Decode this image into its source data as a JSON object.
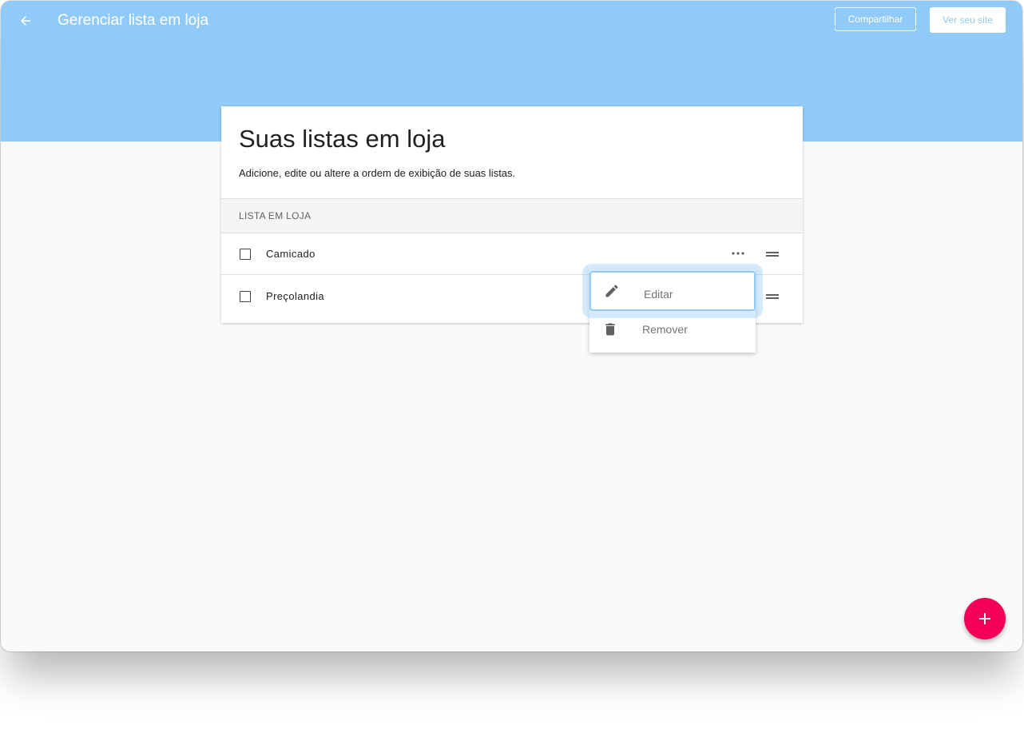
{
  "header": {
    "title": "Gerenciar lista em loja",
    "share_label": "Compartilhar",
    "view_site_label": "Ver seu site",
    "background_color": "#90caf9",
    "back_icon": "arrow-left-icon"
  },
  "card": {
    "title": "Suas listas em loja",
    "subtitle": "Adicione, edite ou altere a ordem de exibição de suas listas.",
    "section_label": "LISTA EM LOJA",
    "items": [
      {
        "label": "Camicado",
        "checked": false
      },
      {
        "label": "Preçolandia",
        "checked": false
      }
    ]
  },
  "context_menu": {
    "items": [
      {
        "label": "Editar",
        "icon": "pencil-icon",
        "highlighted": true
      },
      {
        "label": "Remover",
        "icon": "trash-icon",
        "highlighted": false
      }
    ],
    "highlight_color": "#90caf9"
  },
  "fab": {
    "icon": "plus-icon",
    "color": "#f50057"
  }
}
